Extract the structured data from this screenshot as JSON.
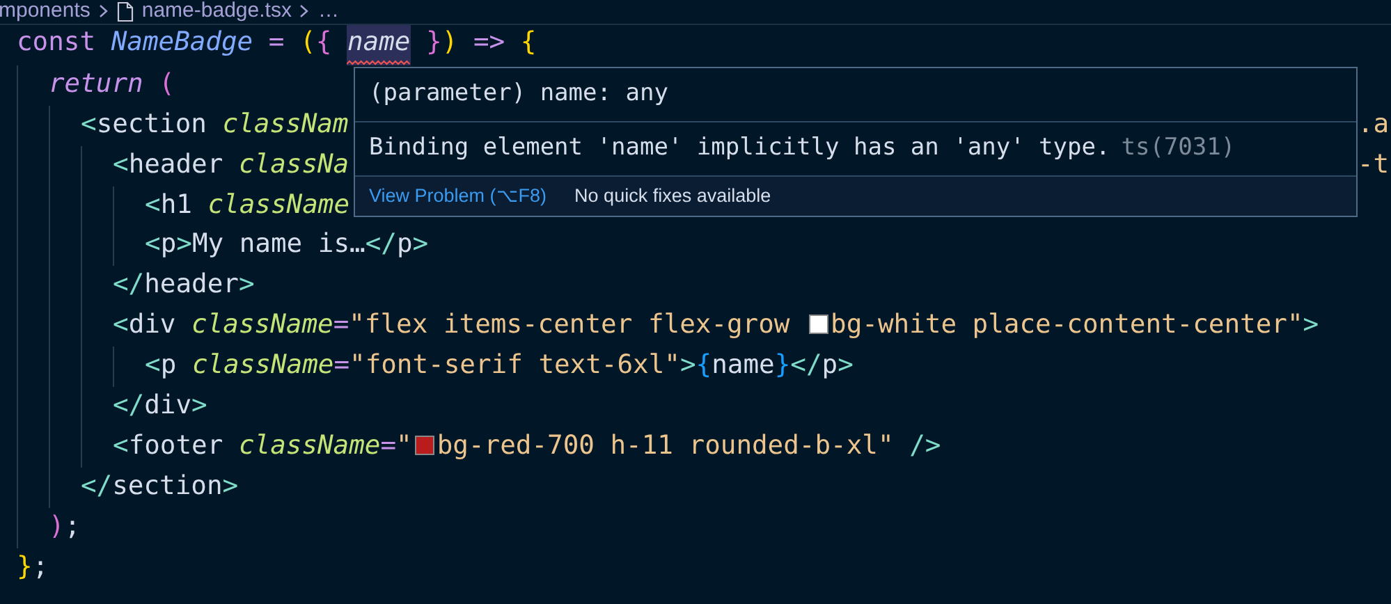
{
  "breadcrumb": [
    {
      "kind": "folder",
      "text": "mponents"
    },
    {
      "kind": "file",
      "text": "name-badge.tsx"
    },
    {
      "kind": "more",
      "text": "…"
    }
  ],
  "code": [
    {
      "tokens": [
        {
          "kind": "keyword",
          "text": "const "
        },
        {
          "kind": "function",
          "text": "NameBadge "
        },
        {
          "kind": "operator",
          "text": "= "
        },
        {
          "kind": "paren",
          "text": "("
        },
        {
          "kind": "brace",
          "text": "{ "
        },
        {
          "kind": "param",
          "text": "name",
          "highlighted": true,
          "squiggle": true
        },
        {
          "kind": "brace",
          "text": " }"
        },
        {
          "kind": "paren",
          "text": ") "
        },
        {
          "kind": "operator",
          "text": "=> "
        },
        {
          "kind": "paren",
          "text": "{"
        }
      ],
      "children": [
        {
          "tokens": [
            {
              "kind": "control",
              "text": "return "
            },
            {
              "kind": "brace",
              "text": "("
            }
          ],
          "children": [
            {
              "tokens": [
                {
                  "kind": "punct",
                  "text": "<"
                },
                {
                  "kind": "tag",
                  "text": "section "
                },
                {
                  "kind": "attr",
                  "text": "classNam"
                }
              ],
              "tail": {
                "kind": "string",
                "text": ".a"
              },
              "children": [
                {
                  "tokens": [
                    {
                      "kind": "punct",
                      "text": "<"
                    },
                    {
                      "kind": "tag",
                      "text": "header "
                    },
                    {
                      "kind": "attr",
                      "text": "classNa"
                    }
                  ],
                  "tail": {
                    "kind": "string",
                    "text": "-t"
                  },
                  "children": [
                    {
                      "tokens": [
                        {
                          "kind": "punct",
                          "text": "<"
                        },
                        {
                          "kind": "tag",
                          "text": "h1 "
                        },
                        {
                          "kind": "attr",
                          "text": "className"
                        }
                      ]
                    },
                    {
                      "tokens": [
                        {
                          "kind": "punct",
                          "text": "<"
                        },
                        {
                          "kind": "tag",
                          "text": "p"
                        },
                        {
                          "kind": "punct",
                          "text": ">"
                        },
                        {
                          "kind": "plain",
                          "text": "My name is…"
                        },
                        {
                          "kind": "punct",
                          "text": "</"
                        },
                        {
                          "kind": "tag",
                          "text": "p"
                        },
                        {
                          "kind": "punct",
                          "text": ">"
                        }
                      ]
                    }
                  ]
                },
                {
                  "tokens": [
                    {
                      "kind": "punct",
                      "text": "</"
                    },
                    {
                      "kind": "tag",
                      "text": "header"
                    },
                    {
                      "kind": "punct",
                      "text": ">"
                    }
                  ]
                },
                {
                  "tokens": [
                    {
                      "kind": "punct",
                      "text": "<"
                    },
                    {
                      "kind": "tag",
                      "text": "div "
                    },
                    {
                      "kind": "attr",
                      "text": "className"
                    },
                    {
                      "kind": "operator",
                      "text": "="
                    },
                    {
                      "kind": "string",
                      "text": "\"flex items-center flex-grow "
                    },
                    {
                      "kind": "swatch",
                      "color": "#ffffff"
                    },
                    {
                      "kind": "string",
                      "text": "bg-white place-content-center\""
                    },
                    {
                      "kind": "punct",
                      "text": ">"
                    }
                  ],
                  "children": [
                    {
                      "tokens": [
                        {
                          "kind": "punct",
                          "text": "<"
                        },
                        {
                          "kind": "tag",
                          "text": "p "
                        },
                        {
                          "kind": "attr",
                          "text": "className"
                        },
                        {
                          "kind": "operator",
                          "text": "="
                        },
                        {
                          "kind": "string",
                          "text": "\"font-serif text-6xl\""
                        },
                        {
                          "kind": "punct",
                          "text": ">"
                        },
                        {
                          "kind": "jsxbrace",
                          "text": "{"
                        },
                        {
                          "kind": "plain",
                          "text": "name"
                        },
                        {
                          "kind": "jsxbrace",
                          "text": "}"
                        },
                        {
                          "kind": "punct",
                          "text": "</"
                        },
                        {
                          "kind": "tag",
                          "text": "p"
                        },
                        {
                          "kind": "punct",
                          "text": ">"
                        }
                      ]
                    }
                  ]
                },
                {
                  "tokens": [
                    {
                      "kind": "punct",
                      "text": "</"
                    },
                    {
                      "kind": "tag",
                      "text": "div"
                    },
                    {
                      "kind": "punct",
                      "text": ">"
                    }
                  ]
                },
                {
                  "tokens": [
                    {
                      "kind": "punct",
                      "text": "<"
                    },
                    {
                      "kind": "tag",
                      "text": "footer "
                    },
                    {
                      "kind": "attr",
                      "text": "className"
                    },
                    {
                      "kind": "operator",
                      "text": "="
                    },
                    {
                      "kind": "string",
                      "text": "\""
                    },
                    {
                      "kind": "swatch",
                      "color": "#b91c1c"
                    },
                    {
                      "kind": "string",
                      "text": "bg-red-700 h-11 rounded-b-xl\" "
                    },
                    {
                      "kind": "punct",
                      "text": "/>"
                    }
                  ]
                }
              ]
            },
            {
              "tokens": [
                {
                  "kind": "punct",
                  "text": "</"
                },
                {
                  "kind": "tag",
                  "text": "section"
                },
                {
                  "kind": "punct",
                  "text": ">"
                }
              ]
            }
          ]
        },
        {
          "tokens": [
            {
              "kind": "brace",
              "text": ")"
            },
            {
              "kind": "plain",
              "text": ";"
            }
          ]
        }
      ]
    },
    {
      "tokens": [
        {
          "kind": "paren",
          "text": "}"
        },
        {
          "kind": "plain",
          "text": ";"
        }
      ]
    }
  ],
  "hover": {
    "signature": "(parameter) name: any",
    "message": "Binding element 'name' implicitly has an 'any' type.",
    "code": "ts(7031)",
    "action": "View Problem (⌥F8)",
    "status": "No quick fixes available"
  }
}
